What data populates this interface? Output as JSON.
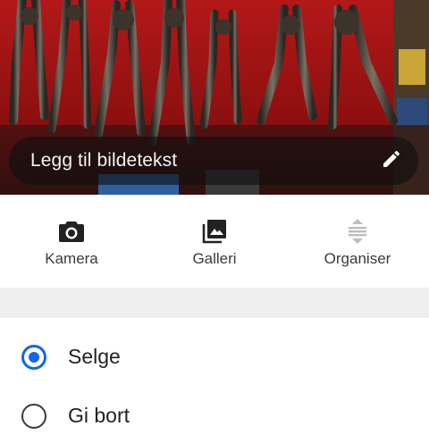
{
  "photo": {
    "caption_placeholder": "Legg til bildetekst",
    "edit_icon": "pencil-icon"
  },
  "actions": [
    {
      "label": "Kamera",
      "icon": "camera-icon"
    },
    {
      "label": "Galleri",
      "icon": "gallery-icon"
    },
    {
      "label": "Organiser",
      "icon": "reorder-icon"
    }
  ],
  "options": [
    {
      "label": "Selge",
      "selected": true
    },
    {
      "label": "Gi bort",
      "selected": false
    }
  ],
  "colors": {
    "accent": "#1565e8",
    "text": "#222222",
    "band": "#efefef"
  }
}
